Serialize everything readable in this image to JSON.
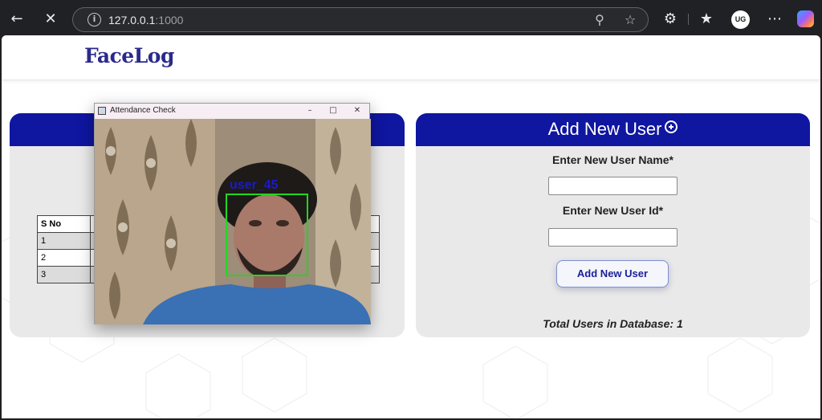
{
  "browser": {
    "url_host": "127.0.0.1",
    "url_port": ":1000",
    "avatar_initials": "UG",
    "icons": [
      "back-arrow-icon",
      "close-icon",
      "info-icon",
      "zoom-out-icon",
      "star-icon",
      "extensions-icon",
      "favorites-icon",
      "more-icon",
      "copilot-icon"
    ]
  },
  "navbar": {
    "brand": "FaceLog"
  },
  "add_user_card": {
    "title": "Add New User",
    "name_label": "Enter New User Name*",
    "name_value": "",
    "id_label": "Enter New User Id*",
    "id_value": "",
    "button_label": "Add New User",
    "total_users": "Total Users in Database: 1"
  },
  "attendance_table": {
    "header": [
      "S No"
    ],
    "rows": [
      {
        "sno": "1"
      },
      {
        "sno": "2"
      },
      {
        "sno": "3"
      }
    ]
  },
  "opencv_window": {
    "title": "Attendance Check",
    "detected_label": "user_45",
    "box_color": "#22d622",
    "label_color": "#1a1acc"
  },
  "colors": {
    "card_header": "#0f16a0",
    "brand": "#2a2a8c"
  }
}
